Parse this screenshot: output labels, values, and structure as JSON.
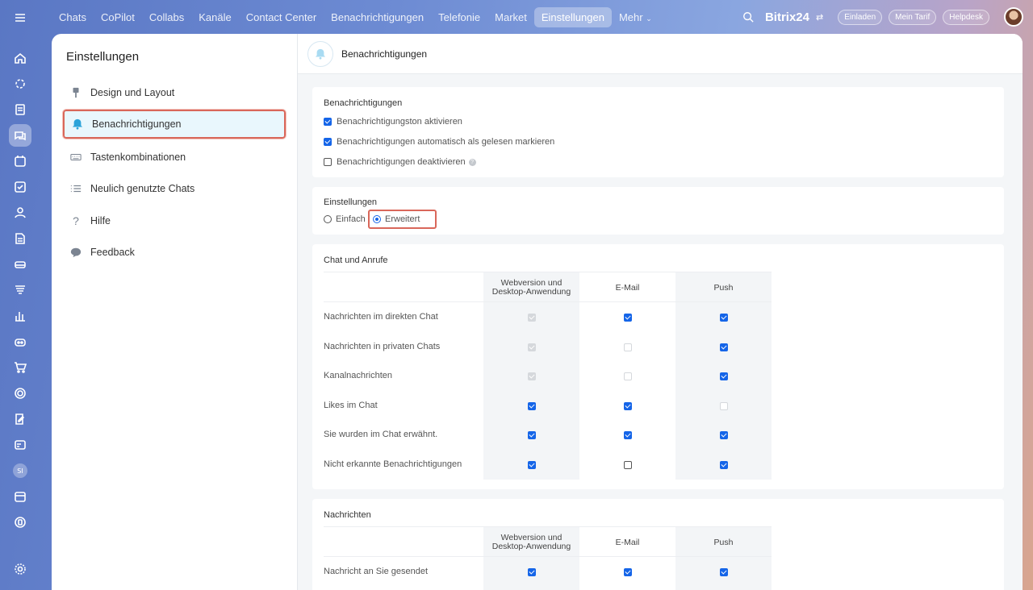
{
  "topnav": {
    "items": [
      "Chats",
      "CoPilot",
      "Collabs",
      "Kanäle",
      "Contact Center",
      "Benachrichtigungen",
      "Telefonie",
      "Market",
      "Einstellungen",
      "Mehr"
    ],
    "active_index": 8
  },
  "header_right": {
    "brand": "Bitrix24",
    "invite": "Einladen",
    "tariff": "Mein Tarif",
    "helpdesk": "Helpdesk"
  },
  "rail": {
    "user_initials": "SI"
  },
  "sidebar": {
    "title": "Einstellungen",
    "items": [
      {
        "label": "Design und Layout",
        "icon": "brush-icon"
      },
      {
        "label": "Benachrichtigungen",
        "icon": "bell-icon"
      },
      {
        "label": "Tastenkombinationen",
        "icon": "keyboard-icon"
      },
      {
        "label": "Neulich genutzte Chats",
        "icon": "list-icon"
      },
      {
        "label": "Hilfe",
        "icon": "question-icon"
      },
      {
        "label": "Feedback",
        "icon": "chat-bubble-icon"
      }
    ],
    "active_index": 1
  },
  "content": {
    "title": "Benachrichtigungen",
    "notifications_card": {
      "title": "Benachrichtigungen",
      "options": [
        {
          "label": "Benachrichtigungston aktivieren",
          "checked": true
        },
        {
          "label": "Benachrichtigungen automatisch als gelesen markieren",
          "checked": true
        },
        {
          "label": "Benachrichtigungen deaktivieren",
          "checked": false
        }
      ]
    },
    "settings_card": {
      "title": "Einstellungen",
      "simple": "Einfach",
      "advanced": "Erweitert",
      "selected": "advanced"
    },
    "columns": [
      "Webversion und Desktop-Anwendung",
      "E-Mail",
      "Push"
    ],
    "chat_card": {
      "title": "Chat und Anrufe",
      "rows": [
        {
          "label": "Nachrichten im direkten Chat",
          "values": [
            "dis-on",
            "on",
            "on"
          ]
        },
        {
          "label": "Nachrichten in privaten Chats",
          "values": [
            "dis-on",
            "dis-off",
            "on"
          ]
        },
        {
          "label": "Kanalnachrichten",
          "values": [
            "dis-on",
            "dis-off",
            "on"
          ]
        },
        {
          "label": "Likes im Chat",
          "values": [
            "on",
            "on",
            "dis-off"
          ]
        },
        {
          "label": "Sie wurden im Chat erwähnt.",
          "values": [
            "on",
            "on",
            "on"
          ]
        },
        {
          "label": "Nicht erkannte Benachrichtigungen",
          "values": [
            "on",
            "off",
            "on"
          ]
        }
      ]
    },
    "messages_card": {
      "title": "Nachrichten",
      "rows": [
        {
          "label": "Nachricht an Sie gesendet",
          "values": [
            "on",
            "on",
            "on"
          ]
        }
      ]
    }
  },
  "colors": {
    "accent": "#1565e8",
    "highlight": "#d9675a",
    "active_bg": "#e9f7fd"
  }
}
